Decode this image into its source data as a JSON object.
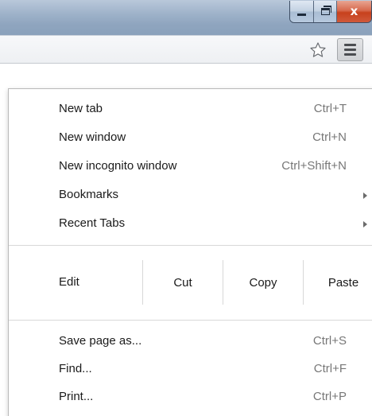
{
  "window": {
    "minimize_icon": "minimize-icon",
    "maximize_icon": "maximize-icon",
    "close_icon": "close-icon",
    "close_glyph": "x"
  },
  "toolbar": {
    "bookmark_icon": "star-icon",
    "menu_icon": "hamburger-menu-icon"
  },
  "menu": {
    "group1": [
      {
        "label": "New tab",
        "shortcut": "Ctrl+T"
      },
      {
        "label": "New window",
        "shortcut": "Ctrl+N"
      },
      {
        "label": "New incognito window",
        "shortcut": "Ctrl+Shift+N"
      },
      {
        "label": "Bookmarks",
        "submenu": true
      },
      {
        "label": "Recent Tabs",
        "submenu": true
      }
    ],
    "edit": {
      "label": "Edit",
      "cut": "Cut",
      "copy": "Copy",
      "paste": "Paste"
    },
    "group2": [
      {
        "label": "Save page as...",
        "shortcut": "Ctrl+S"
      },
      {
        "label": "Find...",
        "shortcut": "Ctrl+F"
      },
      {
        "label": "Print...",
        "shortcut": "Ctrl+P"
      }
    ]
  },
  "colors": {
    "close_red": "#c7411d",
    "shortcut_gray": "#777777",
    "separator": "#d8d8d8"
  }
}
